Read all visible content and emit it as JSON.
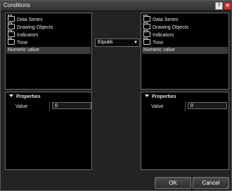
{
  "window": {
    "title": "Conditions",
    "help_label": "?",
    "close_label": "✕"
  },
  "left_tree": {
    "items": [
      "Data Series",
      "Drawing Objects",
      "Indicators",
      "Time"
    ],
    "selected": "Numeric value"
  },
  "right_tree": {
    "items": [
      "Data Series",
      "Drawing Objects",
      "Indicators",
      "Time"
    ],
    "selected": "Numeric value"
  },
  "operator": {
    "value": "Equals",
    "arrow": "▼"
  },
  "left_props": {
    "header": "Properties",
    "label": "Value",
    "value": "0"
  },
  "right_props": {
    "header": "Properties",
    "label": "Value",
    "value": "0"
  },
  "buttons": {
    "ok": "OK",
    "cancel": "Cancel"
  }
}
